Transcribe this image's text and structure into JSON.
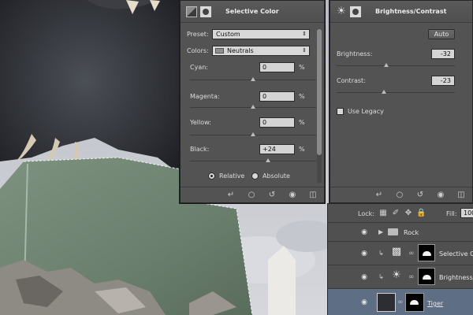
{
  "selective_color": {
    "title": "Selective Color",
    "preset_label": "Preset:",
    "preset_value": "Custom",
    "colors_label": "Colors:",
    "colors_value": "Neutrals",
    "sliders": [
      {
        "label": "Cyan:",
        "value": "0",
        "unit": "%",
        "position": 0.5
      },
      {
        "label": "Magenta:",
        "value": "0",
        "unit": "%",
        "position": 0.5
      },
      {
        "label": "Yellow:",
        "value": "0",
        "unit": "%",
        "position": 0.5
      },
      {
        "label": "Black:",
        "value": "+24",
        "unit": "%",
        "position": 0.62
      }
    ],
    "method_options": [
      "Relative",
      "Absolute"
    ],
    "method_selected": "Relative"
  },
  "brightness_contrast": {
    "title": "Brightness/Contrast",
    "auto_label": "Auto",
    "brightness_label": "Brightness:",
    "brightness_value": "-32",
    "brightness_position": 0.42,
    "contrast_label": "Contrast:",
    "contrast_value": "-23",
    "contrast_position": 0.4,
    "legacy_label": "Use Legacy"
  },
  "layers": {
    "lock_label": "Lock:",
    "fill_label": "Fill:",
    "fill_value": "100",
    "items": [
      {
        "name": "Rock",
        "kind": "group"
      },
      {
        "name": "Selective C...",
        "kind": "selective-color"
      },
      {
        "name": "Brightness/...",
        "kind": "brightness-contrast"
      },
      {
        "name": "Tiger",
        "kind": "pixel"
      }
    ]
  },
  "colors": {
    "panel_bg": "#535353",
    "selected_layer": "#5d6e85",
    "rock_green": "#6f8574",
    "sky": "#c9ccd3"
  }
}
